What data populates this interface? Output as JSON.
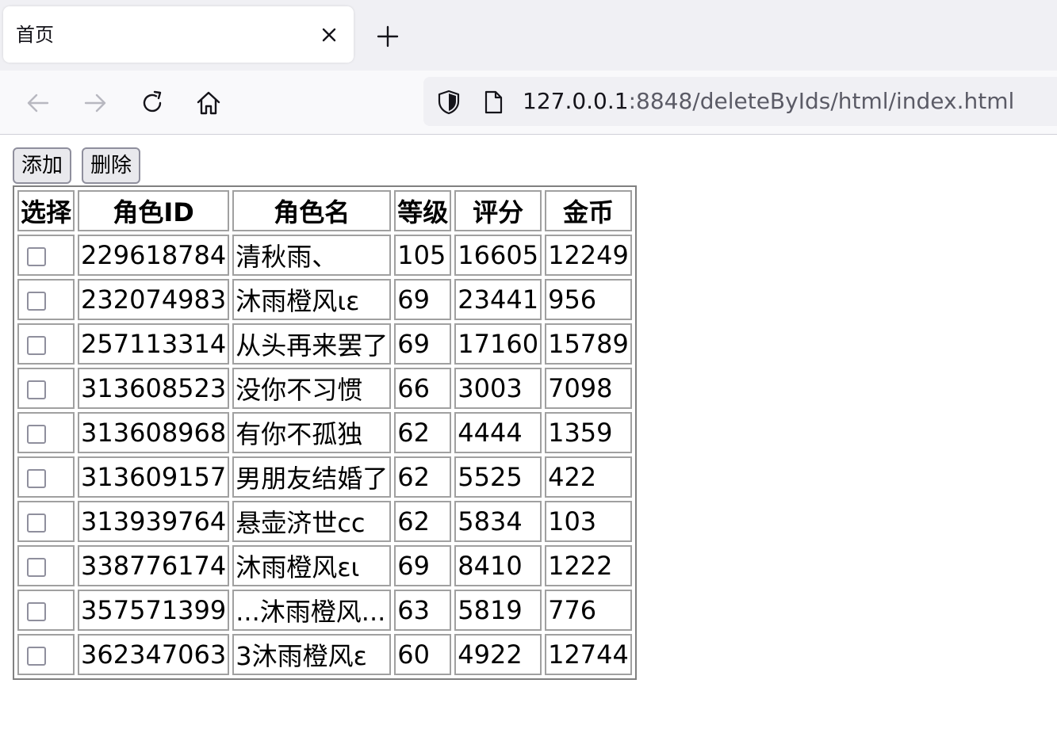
{
  "browser": {
    "tab_title": "首页",
    "url_host": "127.0.0.1",
    "url_rest": ":8848/deleteByIds/html/index.html"
  },
  "toolbar": {
    "add_label": "添加",
    "delete_label": "删除"
  },
  "table": {
    "headers": [
      "选择",
      "角色ID",
      "角色名",
      "等级",
      "评分",
      "金币"
    ],
    "rows": [
      {
        "id": "229618784",
        "name": "清秋雨、",
        "level": "105",
        "score": "16605",
        "gold": "12249"
      },
      {
        "id": "232074983",
        "name": "沐雨橙风ιε",
        "level": "69",
        "score": "23441",
        "gold": "956"
      },
      {
        "id": "257113314",
        "name": "从头再来罢了",
        "level": "69",
        "score": "17160",
        "gold": "15789"
      },
      {
        "id": "313608523",
        "name": "没你不习惯",
        "level": "66",
        "score": "3003",
        "gold": "7098"
      },
      {
        "id": "313608968",
        "name": "有你不孤独",
        "level": "62",
        "score": "4444",
        "gold": "1359"
      },
      {
        "id": "313609157",
        "name": "男朋友结婚了",
        "level": "62",
        "score": "5525",
        "gold": "422"
      },
      {
        "id": "313939764",
        "name": "悬壶济世cc",
        "level": "62",
        "score": "5834",
        "gold": "103"
      },
      {
        "id": "338776174",
        "name": "沐雨橙风ει",
        "level": "69",
        "score": "8410",
        "gold": "1222"
      },
      {
        "id": "357571399",
        "name": "...沐雨橙风...",
        "level": "63",
        "score": "5819",
        "gold": "776"
      },
      {
        "id": "362347063",
        "name": "3沐雨橙风ε",
        "level": "60",
        "score": "4922",
        "gold": "12744"
      }
    ]
  }
}
